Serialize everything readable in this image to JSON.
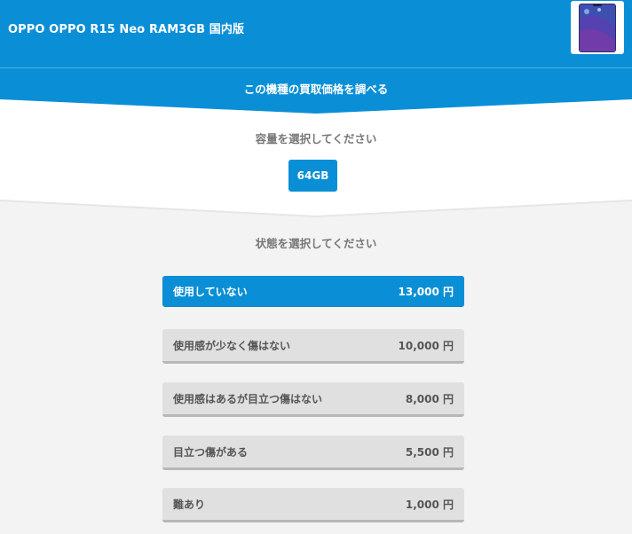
{
  "header": {
    "product_title": "OPPO OPPO R15 Neo RAM3GB 国内版",
    "banner_text": "この機種の買取価格を調べる"
  },
  "capacity": {
    "title": "容量を選択してください",
    "options": [
      {
        "label": "64GB",
        "selected": true
      }
    ]
  },
  "condition": {
    "title": "状態を選択してください",
    "options": [
      {
        "label": "使用していない",
        "price": "13,000 円",
        "selected": true
      },
      {
        "label": "使用感が少なく傷はない",
        "price": "10,000 円",
        "selected": false
      },
      {
        "label": "使用感はあるが目立つ傷はない",
        "price": "8,000 円",
        "selected": false
      },
      {
        "label": "目立つ傷がある",
        "price": "5,500 円",
        "selected": false
      },
      {
        "label": "難あり",
        "price": "1,000 円",
        "selected": false
      }
    ]
  },
  "colors": {
    "brand_blue": "#0a8fd6",
    "option_gray": "#e0e0e0",
    "title_gray": "#777777"
  }
}
